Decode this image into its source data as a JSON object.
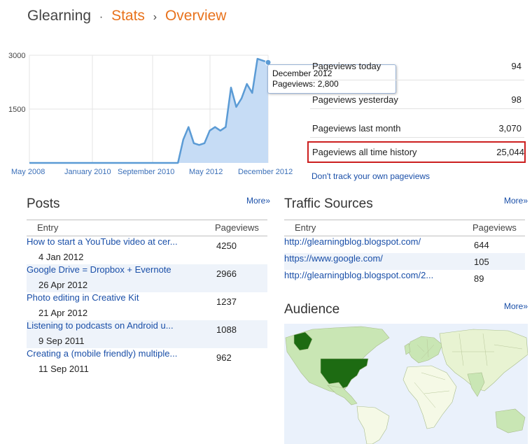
{
  "header": {
    "app": "Glearning",
    "bullet": "·",
    "crumb1": "Stats",
    "chevron": "›",
    "crumb2": "Overview"
  },
  "chart_data": {
    "type": "area",
    "y_ticks": [
      3000,
      1500
    ],
    "ylim": [
      0,
      3000
    ],
    "x_tick_labels": [
      "May 2008",
      "January 2010",
      "September 2010",
      "May 2012",
      "December 2012"
    ],
    "x": [
      "2008-05",
      "2008-06",
      "2008-07",
      "2008-08",
      "2008-09",
      "2008-10",
      "2008-11",
      "2008-12",
      "2009-01",
      "2009-02",
      "2009-03",
      "2009-04",
      "2009-05",
      "2009-06",
      "2009-07",
      "2009-08",
      "2009-09",
      "2009-10",
      "2009-11",
      "2009-12",
      "2010-01",
      "2010-02",
      "2010-03",
      "2010-04",
      "2010-05",
      "2010-06",
      "2010-07",
      "2010-08",
      "2010-09",
      "2010-10",
      "2010-11",
      "2010-12",
      "2011-01",
      "2011-02",
      "2011-03",
      "2011-04",
      "2011-05",
      "2011-06",
      "2011-07",
      "2011-08",
      "2011-09",
      "2011-10",
      "2011-11",
      "2011-12",
      "2012-01",
      "2012-02",
      "2012-03",
      "2012-04",
      "2012-05",
      "2012-06",
      "2012-07",
      "2012-08",
      "2012-09",
      "2012-10",
      "2012-11",
      "2012-12"
    ],
    "series": [
      {
        "values": [
          0,
          0,
          0,
          0,
          0,
          0,
          0,
          0,
          0,
          0,
          0,
          0,
          0,
          0,
          0,
          0,
          0,
          0,
          0,
          0,
          0,
          0,
          0,
          0,
          0,
          0,
          0,
          0,
          0,
          650,
          1000,
          550,
          500,
          550,
          900,
          1000,
          900,
          1000,
          2100,
          1560,
          1800,
          2200,
          1950,
          2900,
          2850,
          2800
        ]
      }
    ],
    "series_color": "#5b9bd5",
    "fill_color": "#c6dcf5",
    "grid": true
  },
  "tooltip": {
    "title": "December 2012",
    "value": "Pageviews: 2,800"
  },
  "stats": [
    {
      "label": "Pageviews today",
      "value": "94"
    },
    {
      "label": "Pageviews yesterday",
      "value": "98"
    },
    {
      "label": "Pageviews last month",
      "value": "3,070"
    },
    {
      "label": "Pageviews all time history",
      "value": "25,044"
    }
  ],
  "dont_track": "Don't track your own pageviews",
  "posts": {
    "title": "Posts",
    "more": "More»",
    "col_entry": "Entry",
    "col_views": "Pageviews",
    "rows": [
      {
        "title": "How to start a YouTube video at cer...",
        "date": "4 Jan 2012",
        "views": "4250"
      },
      {
        "title": "Google Drive = Dropbox + Evernote",
        "date": "26 Apr 2012",
        "views": "2966"
      },
      {
        "title": "Photo editing in Creative Kit",
        "date": "21 Apr 2012",
        "views": "1237"
      },
      {
        "title": "Listening to podcasts on Android u...",
        "date": "9 Sep 2011",
        "views": "1088"
      },
      {
        "title": "Creating a (mobile friendly) multiple...",
        "date": "11 Sep 2011",
        "views": "962"
      }
    ]
  },
  "traffic": {
    "title": "Traffic Sources",
    "more": "More»",
    "col_entry": "Entry",
    "col_views": "Pageviews",
    "rows": [
      {
        "source": "http://glearningblog.blogspot.com/",
        "views": "644"
      },
      {
        "source": "https://www.google.com/",
        "views": "105"
      },
      {
        "source": "http://glearningblog.blogspot.com/2...",
        "views": "89"
      }
    ]
  },
  "audience": {
    "title": "Audience",
    "more": "More»",
    "ocean_color": "#eaf1fb",
    "land_color": "#f5f9e6",
    "light_green": "#c9e6b4",
    "dark_green": "#1d6b12"
  }
}
